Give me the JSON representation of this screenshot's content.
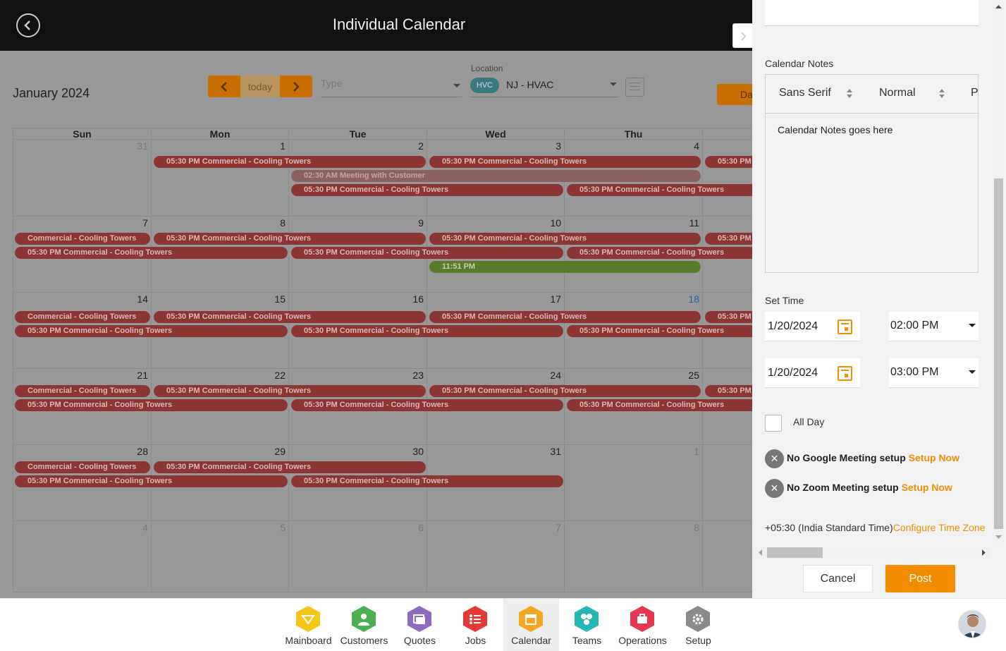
{
  "app": {
    "title": "Individual Calendar"
  },
  "toolbar": {
    "month": "January 2024",
    "today": "today",
    "type_placeholder": "Type",
    "location_label": "Location",
    "location_badge": "HVC",
    "location_value": "NJ - HVAC",
    "view_button": "Da"
  },
  "calendar": {
    "weekdays": [
      "Sun",
      "Mon",
      "Tue",
      "Wed",
      "Thu"
    ],
    "weeks": [
      {
        "days": [
          "31",
          "1",
          "2",
          "3",
          "4"
        ]
      },
      {
        "days": [
          "7",
          "8",
          "9",
          "10",
          "11"
        ]
      },
      {
        "days": [
          "14",
          "15",
          "16",
          "17",
          "18"
        ]
      },
      {
        "days": [
          "21",
          "22",
          "23",
          "24",
          "25"
        ]
      },
      {
        "days": [
          "28",
          "29",
          "30",
          "31",
          "1"
        ]
      },
      {
        "days": [
          "4",
          "5",
          "6",
          "7",
          "8"
        ]
      }
    ],
    "events": {
      "w0": [
        "05:30 PM Commercial - Cooling Towers",
        "05:30 PM Commercial - Cooling Towers",
        "05:30 PM",
        "02:30 AM Meeting with Customer",
        "05:30 PM Commercial - Cooling Towers",
        "05:30 PM Commercial - Cooling Towers"
      ],
      "w1": [
        "Commercial - Cooling Towers",
        "05:30 PM Commercial - Cooling Towers",
        "05:30 PM Commercial - Cooling Towers",
        "05:30 PM",
        "05:30 PM Commercial - Cooling Towers",
        "05:30 PM Commercial - Cooling Towers",
        "05:30 PM Commercial - Cooling Towers",
        "11:51 PM"
      ],
      "w2": [
        "Commercial - Cooling Towers",
        "05:30 PM Commercial - Cooling Towers",
        "05:30 PM Commercial - Cooling Towers",
        "05:30 PM",
        "05:30 PM Commercial - Cooling Towers",
        "05:30 PM Commercial - Cooling Towers",
        "05:30 PM Commercial - Cooling Towers"
      ],
      "w3": [
        "Commercial - Cooling Towers",
        "05:30 PM Commercial - Cooling Towers",
        "05:30 PM Commercial - Cooling Towers",
        "05:30 PM",
        "05:30 PM Commercial - Cooling Towers",
        "05:30 PM Commercial - Cooling Towers",
        "05:30 PM Commercial - Cooling Towers"
      ],
      "w4": [
        "Commercial - Cooling Towers",
        "05:30 PM Commercial - Cooling Towers",
        "05:30 PM Commercial - Cooling Towers",
        "05:30 PM Commercial - Cooling Towers"
      ]
    }
  },
  "panel": {
    "notes_label": "Calendar Notes",
    "font": "Sans Serif",
    "size": "Normal",
    "paragraph": "Para",
    "notes_text": "Calendar Notes goes here",
    "set_time_label": "Set Time",
    "start_date": "1/20/2024",
    "start_time": "02:00 PM",
    "end_date": "1/20/2024",
    "end_time": "03:00 PM",
    "all_day": "All Day",
    "google_text": "No Google Meeting setup",
    "zoom_text": "No Zoom Meeting setup",
    "setup_now": "Setup Now",
    "timezone": "+05:30 (India Standard Time)",
    "configure_tz": "Configure Time Zone",
    "cancel": "Cancel",
    "post": "Post"
  },
  "nav": [
    {
      "label": "Mainboard",
      "icon": "mainboard-icon",
      "color": "#f5c518"
    },
    {
      "label": "Customers",
      "icon": "customers-icon",
      "color": "#4caf50"
    },
    {
      "label": "Quotes",
      "icon": "quotes-icon",
      "color": "#8e6bbf"
    },
    {
      "label": "Jobs",
      "icon": "jobs-icon",
      "color": "#e53935"
    },
    {
      "label": "Calendar",
      "icon": "calendar-icon",
      "color": "#f5a623"
    },
    {
      "label": "Teams",
      "icon": "teams-icon",
      "color": "#26b5b5"
    },
    {
      "label": "Operations",
      "icon": "operations-icon",
      "color": "#e53950"
    },
    {
      "label": "Setup",
      "icon": "setup-icon",
      "color": "#8a8a8a"
    }
  ]
}
